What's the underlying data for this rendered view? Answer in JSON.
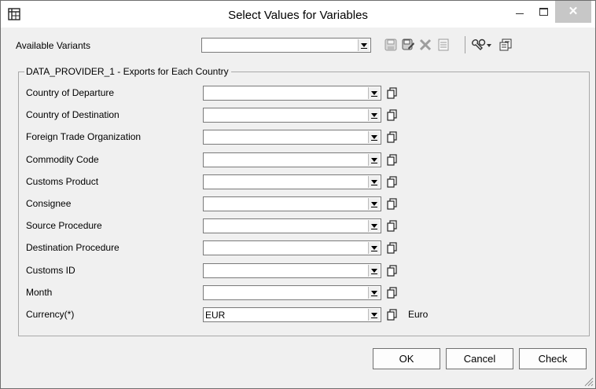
{
  "window": {
    "title": "Select Values for Variables",
    "close_glyph": "✕"
  },
  "variants": {
    "label": "Available Variants",
    "value": ""
  },
  "toolbar": {
    "icons": [
      "save-icon",
      "save-as-icon",
      "delete-icon",
      "details-icon",
      "tools-dropdown-icon",
      "personalize-icon"
    ]
  },
  "group": {
    "legend": "DATA_PROVIDER_1 - Exports for Each Country"
  },
  "variables": [
    {
      "label": "Country of Departure",
      "value": "",
      "description": ""
    },
    {
      "label": "Country of Destination",
      "value": "",
      "description": ""
    },
    {
      "label": "Foreign Trade Organization",
      "value": "",
      "description": ""
    },
    {
      "label": "Commodity Code",
      "value": "",
      "description": ""
    },
    {
      "label": "Customs Product",
      "value": "",
      "description": ""
    },
    {
      "label": "Consignee",
      "value": "",
      "description": ""
    },
    {
      "label": "Source Procedure",
      "value": "",
      "description": ""
    },
    {
      "label": "Destination Procedure",
      "value": "",
      "description": ""
    },
    {
      "label": "Customs ID",
      "value": "",
      "description": ""
    },
    {
      "label": "Month",
      "value": "",
      "description": ""
    },
    {
      "label": "Currency(*)",
      "value": "EUR",
      "description": "Euro"
    }
  ],
  "buttons": {
    "ok": "OK",
    "cancel": "Cancel",
    "check": "Check"
  },
  "colors": {
    "close_button": "#c7c7c7",
    "window_bg": "#f0f0f0"
  }
}
